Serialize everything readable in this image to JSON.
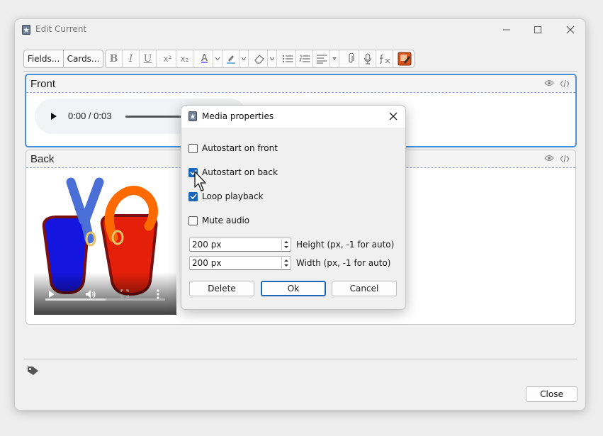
{
  "window": {
    "title": "Edit Current",
    "controls": {
      "minimize": "minimize",
      "maximize": "maximize",
      "close": "close"
    }
  },
  "toolbar": {
    "fields_label": "Fields...",
    "cards_label": "Cards...",
    "bold": "B",
    "italic": "I",
    "underline": "U",
    "superscript": "x²",
    "subscript": "x₂",
    "font_color_letter": "A",
    "colors": {
      "font_color": "#8b7cf6",
      "highlight": "#7fb3e6",
      "last_button": "#d9541e"
    }
  },
  "fields": [
    {
      "name": "Front",
      "audio": {
        "time": "0:00 / 0:03"
      }
    },
    {
      "name": "Back"
    }
  ],
  "dialog": {
    "title": "Media properties",
    "options": [
      {
        "label": "Autostart on front",
        "checked": false
      },
      {
        "label": "Autostart on back",
        "checked": true
      },
      {
        "label": "Loop playback",
        "checked": true
      },
      {
        "label": "Mute audio",
        "checked": false
      }
    ],
    "height": {
      "value": "200 px",
      "label": "Height (px, -1 for auto)"
    },
    "width": {
      "value": "200 px",
      "label": "Width (px, -1 for auto)"
    },
    "buttons": {
      "delete": "Delete",
      "ok": "Ok",
      "cancel": "Cancel"
    }
  },
  "footer": {
    "close_label": "Close"
  }
}
